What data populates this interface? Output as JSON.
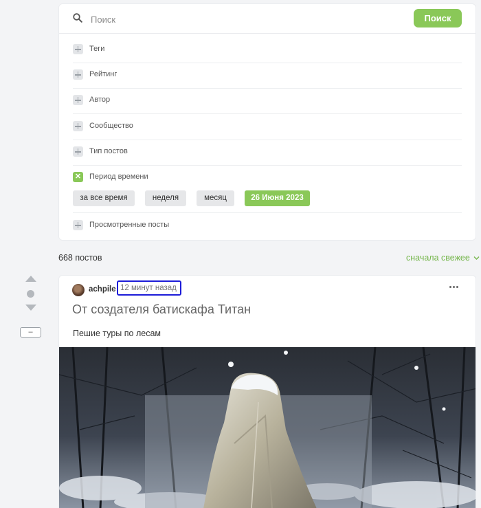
{
  "search": {
    "placeholder": "Поиск",
    "button_label": "Поиск"
  },
  "filters": {
    "tags": "Теги",
    "rating": "Рейтинг",
    "author": "Автор",
    "community": "Сообщество",
    "post_type": "Тип постов",
    "period": "Период времени",
    "viewed": "Просмотренные посты"
  },
  "period_options": [
    "за все время",
    "неделя",
    "месяц",
    "26 Июня 2023"
  ],
  "period_selected": "26 Июня 2023",
  "feed": {
    "count": "668 постов",
    "sort": "сначала свежее"
  },
  "rail": {
    "collapse_label": "–"
  },
  "post": {
    "author": "achpile",
    "time": "12 минут назад",
    "title": "От создателя батискафа Титан",
    "text": "Пешие туры по лесам"
  },
  "colors": {
    "accent": "#8ac858",
    "highlight": "#1c1bd8",
    "link": "#74b54a"
  },
  "icons": {
    "search": "search-icon",
    "more": "more-icon",
    "check": "check-icon",
    "plus": "plus-icon"
  }
}
